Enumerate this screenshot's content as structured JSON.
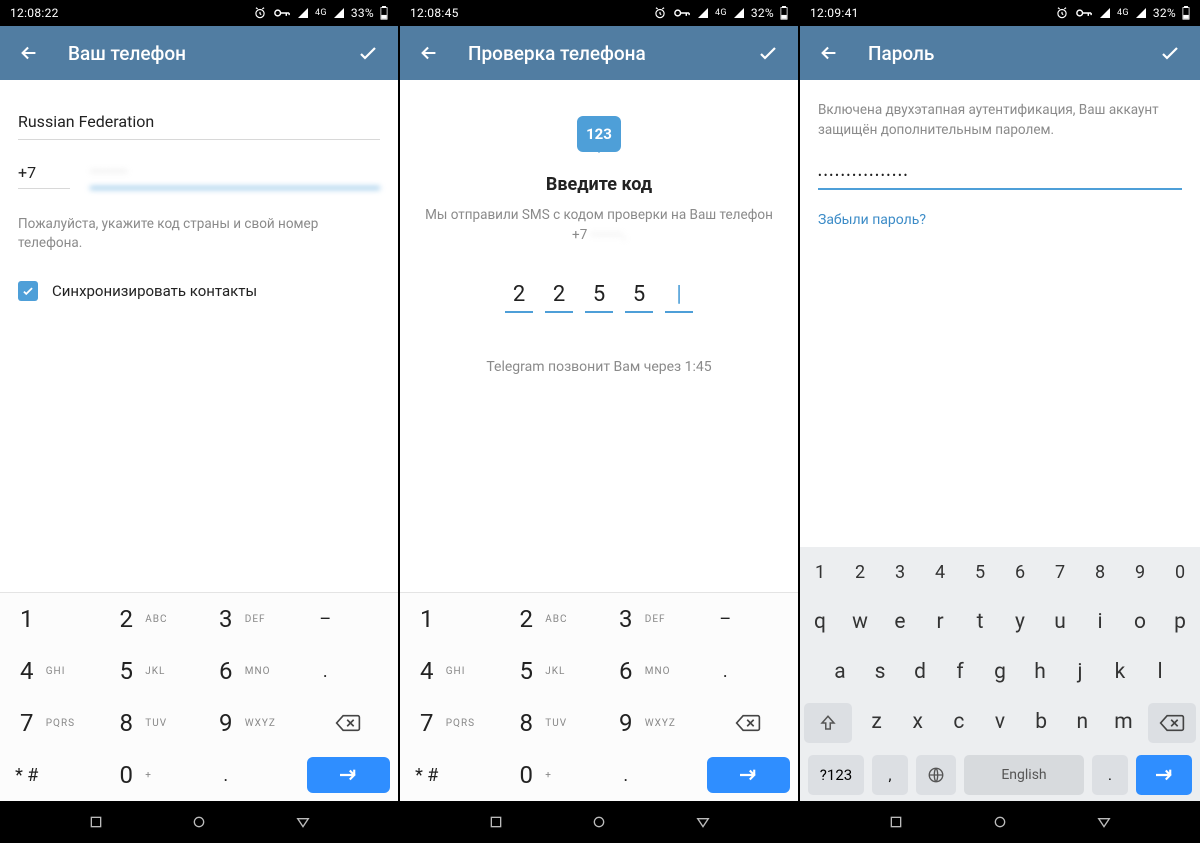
{
  "screen1": {
    "status": {
      "time": "12:08:22",
      "battery": "33%"
    },
    "title": "Ваш телефон",
    "country": "Russian Federation",
    "countryCode": "+7",
    "phoneNumber": "·········",
    "hint": "Пожалуйста, укажите код страны и свой номер телефона.",
    "syncLabel": "Синхронизировать контакты"
  },
  "screen2": {
    "status": {
      "time": "12:08:45",
      "battery": "32%"
    },
    "title": "Проверка телефона",
    "bubbleText": "123",
    "heading": "Введите код",
    "subtext1": "Мы отправили SMS с кодом проверки на Ваш телефон",
    "subtextPrefix": "+7",
    "codeDigits": [
      "2",
      "2",
      "5",
      "5",
      ""
    ],
    "callHint": "Telegram позвонит Вам через 1:45"
  },
  "screen3": {
    "status": {
      "time": "12:09:41",
      "battery": "32%"
    },
    "title": "Пароль",
    "desc": "Включена двухэтапная аутентификация, Ваш аккаунт защищён дополнительным паролем.",
    "passwordMask": "••••••••••••••••",
    "forgot": "Забыли пароль?"
  },
  "dialer": {
    "rows": [
      [
        {
          "n": "1",
          "l": ""
        },
        {
          "n": "2",
          "l": "ABC"
        },
        {
          "n": "3",
          "l": "DEF"
        },
        {
          "n": "–",
          "l": "",
          "sym": true
        }
      ],
      [
        {
          "n": "4",
          "l": "GHI"
        },
        {
          "n": "5",
          "l": "JKL"
        },
        {
          "n": "6",
          "l": "MNO"
        },
        {
          "n": ".",
          "l": "",
          "sym": true
        }
      ],
      [
        {
          "n": "7",
          "l": "PQRS"
        },
        {
          "n": "8",
          "l": "TUV"
        },
        {
          "n": "9",
          "l": "WXYZ"
        },
        {
          "icon": "backspace"
        }
      ],
      [
        {
          "n": "* #",
          "l": "",
          "sym": true
        },
        {
          "n": "0",
          "l": "+"
        },
        {
          "n": ".",
          "l": "",
          "sym": true
        },
        {
          "icon": "enter"
        }
      ]
    ]
  },
  "qwerty": {
    "rowNums": [
      "1",
      "2",
      "3",
      "4",
      "5",
      "6",
      "7",
      "8",
      "9",
      "0"
    ],
    "row1": [
      "q",
      "w",
      "e",
      "r",
      "t",
      "y",
      "u",
      "i",
      "o",
      "p"
    ],
    "row2": [
      "a",
      "s",
      "d",
      "f",
      "g",
      "h",
      "j",
      "k",
      "l"
    ],
    "row3": [
      "z",
      "x",
      "c",
      "v",
      "b",
      "n",
      "m"
    ],
    "symKey": "?123",
    "spaceLabel": "English"
  }
}
